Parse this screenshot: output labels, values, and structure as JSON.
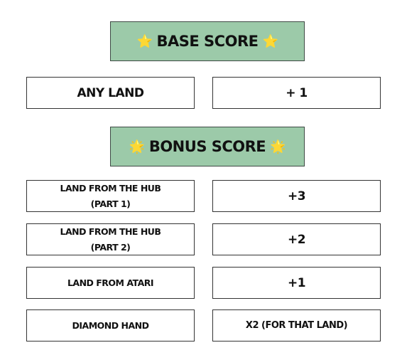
{
  "base": {
    "title": "BASE SCORE",
    "icon": "star-icon",
    "star": "⭐",
    "rows": [
      {
        "label": "ANY LAND",
        "value": "+ 1"
      }
    ]
  },
  "bonus": {
    "title": "BONUS SCORE",
    "icon": "glowing-star-icon",
    "star": "🌟",
    "rows": [
      {
        "label_line1": "LAND FROM THE HUB",
        "label_line2": "(PART 1)",
        "value": "+3"
      },
      {
        "label_line1": "LAND FROM THE HUB",
        "label_line2": "(PART 2)",
        "value": "+2"
      },
      {
        "label": "LAND FROM ATARI",
        "value": "+1"
      },
      {
        "label": "DIAMOND HAND",
        "value": "X2 (FOR THAT LAND)"
      }
    ]
  },
  "colors": {
    "header_bg": "#9ccaa9",
    "border": "#333333"
  }
}
